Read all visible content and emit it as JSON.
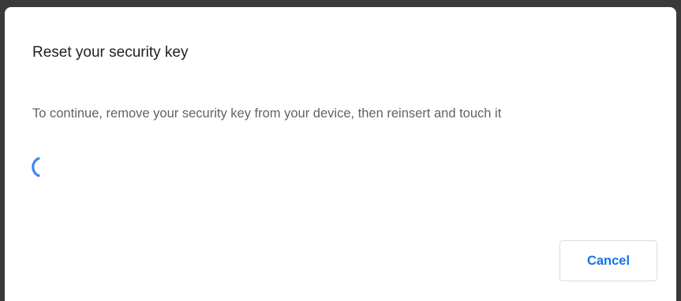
{
  "dialog": {
    "title": "Reset your security key",
    "message": "To continue, remove your security key from your device, then reinsert and touch it",
    "spinner_icon": "progress-spinner-icon",
    "cancel_label": "Cancel"
  },
  "colors": {
    "accent": "#1a73e8",
    "spinner": "#4285f4",
    "title_text": "#202124",
    "body_text": "#5f6368",
    "button_border": "#dadce0"
  }
}
